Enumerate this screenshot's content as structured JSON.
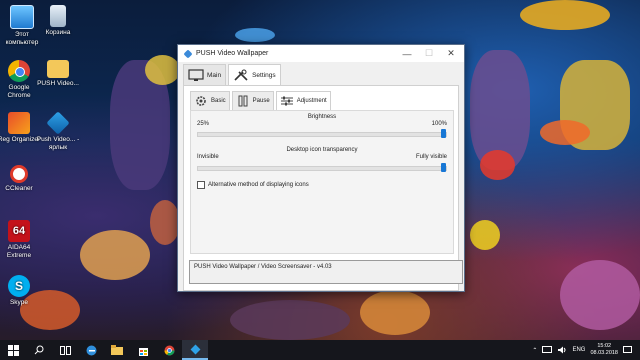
{
  "desktop": {
    "icons": [
      {
        "label": "Этот компьютер",
        "icon": "computer-icon"
      },
      {
        "label": "Корзина",
        "icon": "recycle-bin-icon"
      },
      {
        "label": "Google Chrome",
        "icon": "chrome-icon"
      },
      {
        "label": "PUSH Video...",
        "icon": "folder-icon"
      },
      {
        "label": "Reg Organizer",
        "icon": "reg-organizer-icon"
      },
      {
        "label": "Push Video... - ярлык",
        "icon": "push-video-icon"
      },
      {
        "label": "CCleaner",
        "icon": "ccleaner-icon"
      },
      {
        "label": "AIDA64 Extreme",
        "icon": "aida64-icon"
      },
      {
        "label": "Skype",
        "icon": "skype-icon"
      }
    ]
  },
  "window": {
    "title": "PUSH Video Wallpaper",
    "controls": {
      "minimize": "—",
      "maximize": "☐",
      "close": "✕"
    },
    "tabs": [
      {
        "label": "Main",
        "icon": "monitor-icon",
        "active": false
      },
      {
        "label": "Settings",
        "icon": "tools-icon",
        "active": true
      }
    ],
    "subtabs": [
      {
        "label": "Basic",
        "icon": "gear-icon",
        "active": false
      },
      {
        "label": "Pause",
        "icon": "pause-icon",
        "active": false
      },
      {
        "label": "Adjustment",
        "icon": "sliders-icon",
        "active": true
      }
    ],
    "brightness": {
      "title": "Brightness",
      "min_label": "25%",
      "max_label": "100%",
      "value_fraction": 1.0
    },
    "transparency": {
      "title": "Desktop icon transparency",
      "min_label": "Invisible",
      "max_label": "Fully visible",
      "value_fraction": 1.0
    },
    "alt_method": {
      "label": "Alternative method of displaying icons",
      "checked": false
    },
    "status_text": "PUSH Video Wallpaper / Video Screensaver - v4.03"
  },
  "taskbar": {
    "lang": "ENG",
    "time": "15:02",
    "date": "08.03.2018",
    "accent": "#76b9ed"
  }
}
